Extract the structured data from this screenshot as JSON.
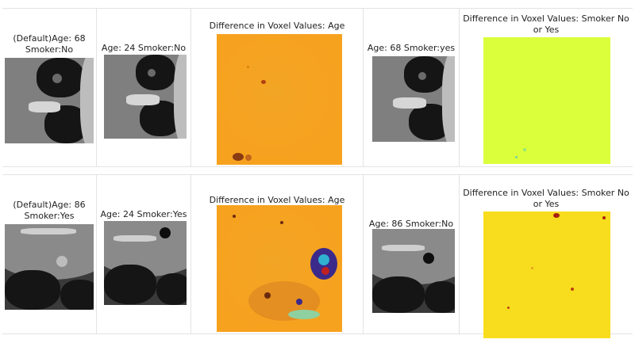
{
  "rows": [
    {
      "cells": [
        {
          "caption": "(Default)Age: 68 Smoker:No"
        },
        {
          "caption": "Age: 24 Smoker:No"
        },
        {
          "caption": "Difference in Voxel Values: Age"
        },
        {
          "caption": "Age: 68 Smoker:yes"
        },
        {
          "caption": "Difference in Voxel Values: Smoker No or Yes"
        }
      ]
    },
    {
      "cells": [
        {
          "caption": "(Default)Age: 86 Smoker:Yes"
        },
        {
          "caption": "Age: 24 Smoker:Yes"
        },
        {
          "caption": "Difference in Voxel Values: Age"
        },
        {
          "caption": "Age: 86 Smoker:No"
        },
        {
          "caption": "Difference in Voxel Values: Smoker No or Yes"
        }
      ]
    }
  ],
  "colors": {
    "age_diff_base": "#f7a21f",
    "smoker_diff_row1": "#dcff3c",
    "smoker_diff_row2": "#f8dd1e",
    "grid_line": "#e3e3e3"
  }
}
